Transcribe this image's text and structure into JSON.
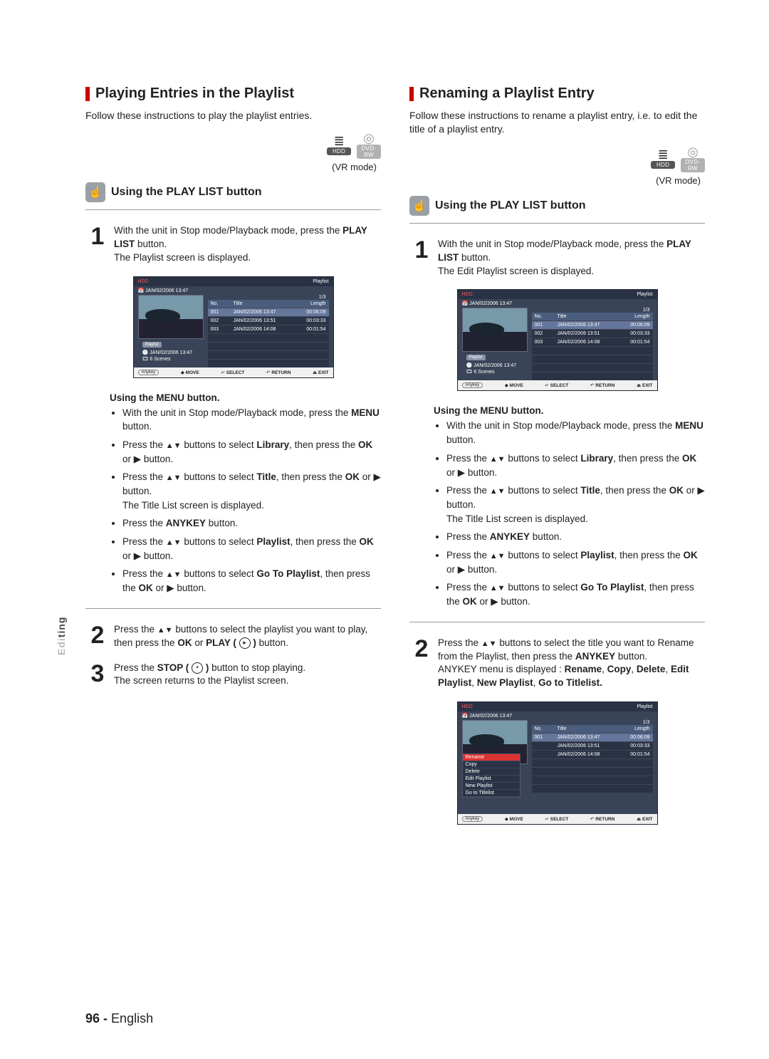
{
  "left": {
    "title": "Playing Entries in the Playlist",
    "intro": "Follow these instructions to play the playlist entries.",
    "media": [
      {
        "glyph": "≣",
        "label": "HDD",
        "muted": false
      },
      {
        "glyph": "◎",
        "label": "DVD-RW",
        "muted": true
      }
    ],
    "vr": "(VR mode)",
    "subheading": "Using the PLAY LIST button",
    "step1_a": "With the unit in Stop mode/Playback mode, press the ",
    "step1_b": "PLAY LIST",
    "step1_c": " button.",
    "step1_d": "The Playlist screen is displayed.",
    "menu_heading": "Using the MENU button.",
    "menu_items": [
      "With the unit in Stop mode/Playback mode, press the <b>MENU</b> button.",
      "Press the <span class='tri'>▲▼</span> buttons to select <b>Library</b>, then press the <b>OK</b> or ▶ button.",
      "Press the <span class='tri'>▲▼</span> buttons to select <b>Title</b>, then press the <b>OK</b> or ▶ button.<br>The Title List screen is displayed.",
      "Press the <b>ANYKEY</b> button.",
      "Press the <span class='tri'>▲▼</span> buttons to select <b>Playlist</b>, then press the <b>OK</b> or ▶ button.",
      "Press the <span class='tri'>▲▼</span> buttons to select <b>Go To Playlist</b>, then press the <b>OK</b> or ▶ button."
    ],
    "step2": "Press the <span class='tri'>▲▼</span> buttons to select the playlist you want to play, then press the <b>OK</b> or <b>PLAY (</b> <span class='circ'>▸</span> <b>)</b> button.",
    "step3": "Press the <b>STOP (</b> <span class='circ'>•</span> <b>)</b> button to stop playing.<br>The screen returns to the Playlist screen."
  },
  "right": {
    "title": "Renaming a Playlist Entry",
    "intro": "Follow these instructions to rename a playlist entry, i.e. to edit the title of a playlist entry.",
    "media": [
      {
        "glyph": "≣",
        "label": "HDD",
        "muted": false
      },
      {
        "glyph": "◎",
        "label": "DVD-RW",
        "muted": true
      }
    ],
    "vr": "(VR mode)",
    "subheading": "Using the PLAY LIST button",
    "step1_a": "With the unit in Stop mode/Playback mode, press the ",
    "step1_b": "PLAY LIST",
    "step1_c": " button.",
    "step1_d": "The Edit Playlist screen is displayed.",
    "menu_heading": "Using the MENU button.",
    "menu_items": [
      "With the unit in Stop mode/Playback mode, press the <b>MENU</b> button.",
      "Press the <span class='tri'>▲▼</span> buttons to select <b>Library</b>, then press the <b>OK</b> or ▶ button.",
      "Press the <span class='tri'>▲▼</span> buttons to select <b>Title</b>, then press the <b>OK</b> or ▶ button.<br>The Title List screen is displayed.",
      "Press the <b>ANYKEY</b> button.",
      "Press the <span class='tri'>▲▼</span> buttons to select <b>Playlist</b>, then press the <b>OK</b> or ▶ button.",
      "Press the <span class='tri'>▲▼</span> buttons to select <b>Go To Playlist</b>, then press the <b>OK</b> or ▶ button."
    ],
    "step2": "Press the <span class='tri'>▲▼</span> buttons to select the title you want to Rename from the Playlist, then press the <b>ANYKEY</b> button.<br>ANYKEY menu is displayed : <b>Rename</b>, <b>Copy</b>, <b>Delete</b>, <b>Edit Playlist</b>, <b>New Playlist</b>, <b>Go to Titlelist.</b>"
  },
  "osd": {
    "hdr_left": "HDD",
    "hdr_right": "Playlist",
    "date": "JAN/02/2006 13:47",
    "page_indicator": "1/3",
    "cols": {
      "no": "No.",
      "title": "Title",
      "length": "Length"
    },
    "rows": [
      {
        "no": "001",
        "title": "JAN/02/2006 13:47",
        "length": "00:06:09"
      },
      {
        "no": "002",
        "title": "JAN/02/2006 13:51",
        "length": "00:03:33"
      },
      {
        "no": "003",
        "title": "JAN/02/2006 14:08",
        "length": "00:01:54"
      }
    ],
    "tag": "Playlist",
    "meta_time": "JAN/02/2006 13:47",
    "meta_scenes": "6 Scenes",
    "bar": {
      "anykey": "Anykey",
      "move": "MOVE",
      "select": "SELECT",
      "return": "RETURN",
      "exit": "EXIT"
    },
    "ctx": [
      "Rename",
      "Copy",
      "Delete",
      "Edit Playlist",
      "New Playlist",
      "Go to Titlelist"
    ]
  },
  "side_tab": {
    "dim": "Edi",
    "em": "ting"
  },
  "footer": {
    "page": "96 -",
    "lang": "English"
  }
}
